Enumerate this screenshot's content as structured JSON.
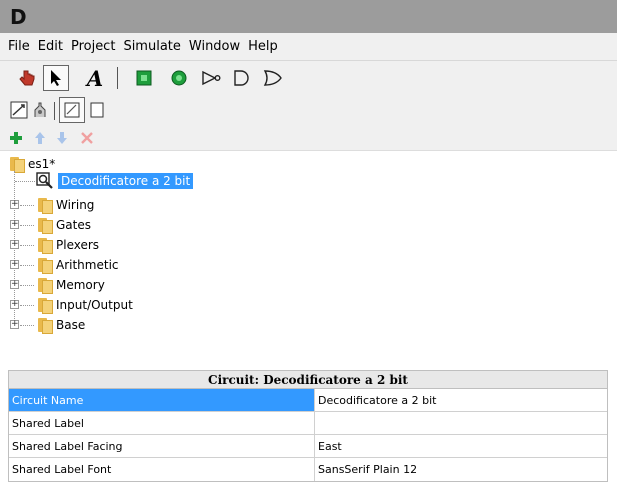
{
  "window": {
    "app_logo": "D"
  },
  "menu": [
    "File",
    "Edit",
    "Project",
    "Simulate",
    "Window",
    "Help"
  ],
  "toolbar": {
    "tools": [
      "hand-poke-icon",
      "arrow-select-icon",
      "text-tool-icon",
      "input-pin-icon",
      "output-pin-icon",
      "not-gate-icon",
      "and-gate-icon",
      "or-gate-icon"
    ],
    "text_tool_glyph": "A"
  },
  "toolbar2": {
    "tools": [
      "layout-view-icon",
      "appearance-view-icon",
      "table-view-icon",
      "blank-view-icon"
    ]
  },
  "toolbar3": {
    "tools": [
      "add-circuit-icon",
      "move-up-icon",
      "move-down-icon",
      "delete-icon"
    ]
  },
  "tree": {
    "project": "es1*",
    "circuit": "Decodificatore a 2 bit",
    "libraries": [
      "Wiring",
      "Gates",
      "Plexers",
      "Arithmetic",
      "Memory",
      "Input/Output",
      "Base"
    ]
  },
  "attributes": {
    "title": "Circuit: Decodificatore a 2 bit",
    "rows": [
      {
        "name": "Circuit Name",
        "value": "Decodificatore a 2 bit"
      },
      {
        "name": "Shared Label",
        "value": ""
      },
      {
        "name": "Shared Label Facing",
        "value": "East"
      },
      {
        "name": "Shared Label Font",
        "value": "SansSerif Plain 12"
      }
    ]
  },
  "colors": {
    "selection": "#3399ff",
    "title_bar": "#9c9c9c",
    "accent_green": "#1e9e3c"
  }
}
